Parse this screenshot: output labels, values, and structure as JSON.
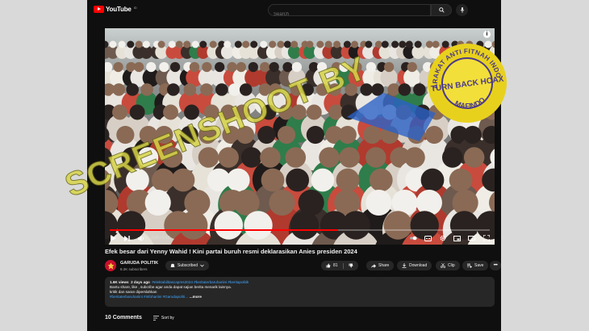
{
  "header": {
    "logo_text": "YouTube",
    "logo_sup": "ID",
    "search_placeholder": "Search"
  },
  "player": {
    "time": "3:09 / 5:19",
    "progress_fraction": 0.6
  },
  "video": {
    "title": "Efek besar dari Yenny Wahid ! Kini partai buruh resmi deklarasikan Anies presiden 2024"
  },
  "channel": {
    "name": "GARUDA POLITIK",
    "subscribers": "8.2K subscribers",
    "subscribe_label": "Subscribed",
    "like_count": "81",
    "share_label": "Share",
    "download_label": "Download",
    "clip_label": "Clip",
    "save_label": "Save"
  },
  "description": {
    "views": "1.6K views",
    "age": "2 days ago",
    "hashtags_top": "#elektabilitascapres2024 #beritaterbaruhariini #beritapolitik",
    "line1": "Bantu share, like , subcribe agar anda dapat sajian berita menarik lainnya.",
    "line2": "kritik dan saran diperslahkan",
    "hashtags_bottom": "#beritaterbaruhariini #infohariini #Garudapoliti…",
    "more": "...more"
  },
  "comments": {
    "count_label": "10 Comments",
    "sort_label": "Sort by"
  },
  "overlay": {
    "watermark": "SCREENSHOOT BY",
    "badge_ring": "MASYARAKAT ANTI FITNAH INDONESIA",
    "badge_bottom": "MAFINDO",
    "badge_center": "TURN BACK HOAX"
  },
  "colors": {
    "accent": "#ff0000",
    "watermark": "#d8d54a",
    "badge_bg": "#e8d11d",
    "badge_text": "#4b3a8c"
  }
}
